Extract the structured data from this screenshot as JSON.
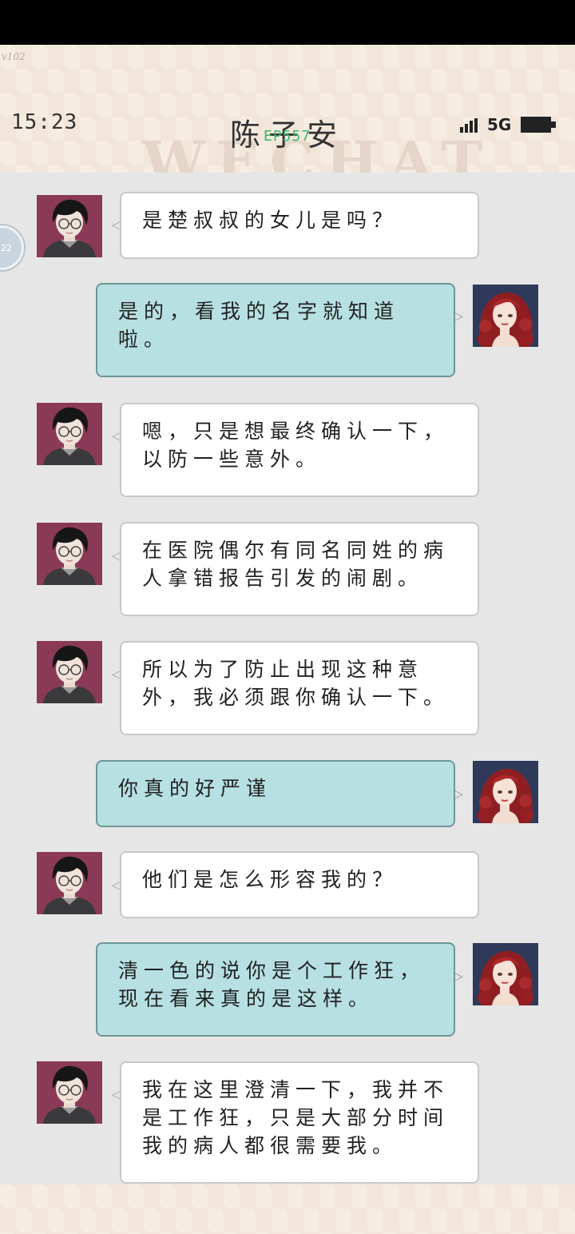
{
  "header": {
    "version": "v102",
    "time": "15:23",
    "contact_name": "陈子安",
    "debug_label": "EP557",
    "watermark": "WECHAT",
    "network": "5G",
    "float_button_text": "22"
  },
  "colors": {
    "header_bg": "#f6ece2",
    "chat_bg": "#e6e6e6",
    "bubble_left": "#ffffff",
    "bubble_right": "#b7e0e3",
    "bubble_right_border": "#6f9597"
  },
  "messages": [
    {
      "sender": "陈子安",
      "side": "left",
      "avatar": "male-avatar-icon",
      "text": "是楚叔叔的女儿是吗？"
    },
    {
      "sender": "me",
      "side": "right",
      "avatar": "female-avatar-icon",
      "text": "是的，看我的名字就知道啦。"
    },
    {
      "sender": "陈子安",
      "side": "left",
      "avatar": "male-avatar-icon",
      "text": "嗯，只是想最终确认一下，以防一些意外。"
    },
    {
      "sender": "陈子安",
      "side": "left",
      "avatar": "male-avatar-icon",
      "text": "在医院偶尔有同名同姓的病人拿错报告引发的闹剧。"
    },
    {
      "sender": "陈子安",
      "side": "left",
      "avatar": "male-avatar-icon",
      "text": "所以为了防止出现这种意外，我必须跟你确认一下。"
    },
    {
      "sender": "me",
      "side": "right",
      "avatar": "female-avatar-icon",
      "text": "你真的好严谨"
    },
    {
      "sender": "陈子安",
      "side": "left",
      "avatar": "male-avatar-icon",
      "text": "他们是怎么形容我的？"
    },
    {
      "sender": "me",
      "side": "right",
      "avatar": "female-avatar-icon",
      "text": "清一色的说你是个工作狂，现在看来真的是这样。"
    },
    {
      "sender": "陈子安",
      "side": "left",
      "avatar": "male-avatar-icon",
      "text": "我在这里澄清一下，我并不是工作狂，只是大部分时间我的病人都很需要我。"
    }
  ]
}
